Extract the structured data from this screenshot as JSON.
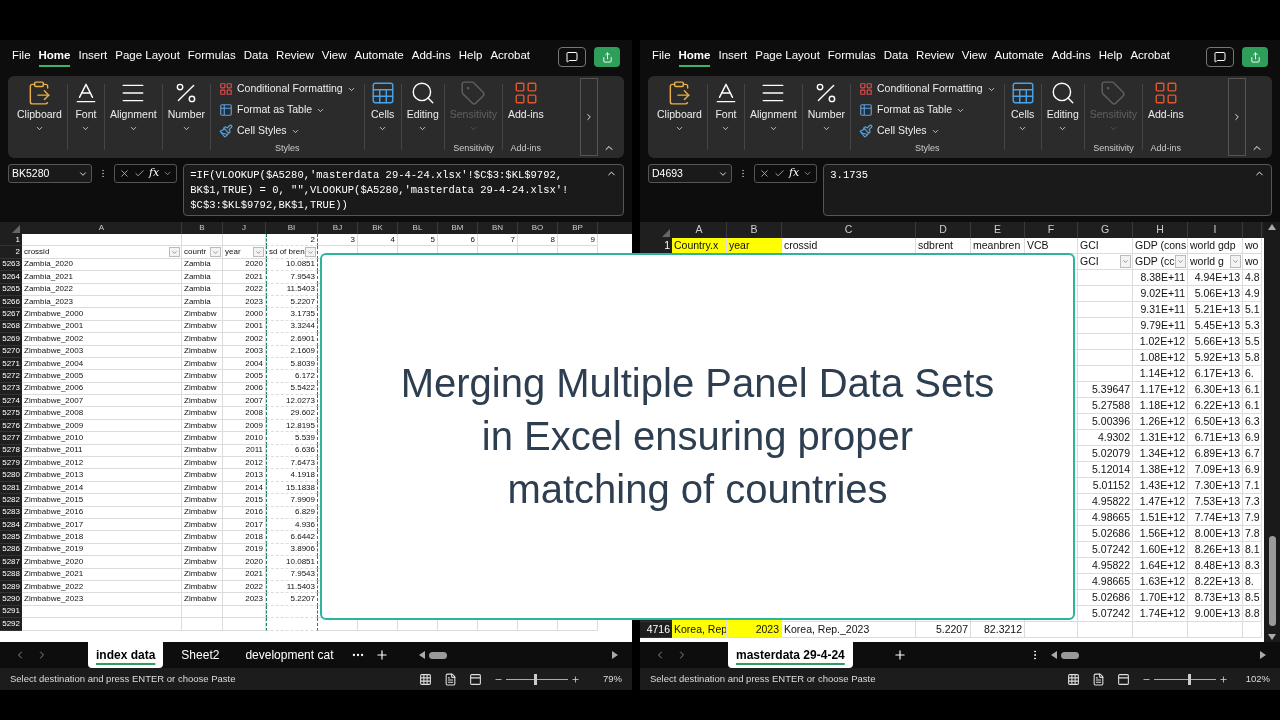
{
  "windows": [
    {
      "menu_tabs": [
        {
          "label": "File",
          "selected": false
        },
        {
          "label": "Home",
          "selected": true
        },
        {
          "label": "Insert",
          "selected": false
        },
        {
          "label": "Page Layout",
          "selected": false
        },
        {
          "label": "Formulas",
          "selected": false
        },
        {
          "label": "Data",
          "selected": false
        },
        {
          "label": "Review",
          "selected": false
        },
        {
          "label": "View",
          "selected": false
        },
        {
          "label": "Automate",
          "selected": false
        },
        {
          "label": "Add-ins",
          "selected": false
        },
        {
          "label": "Help",
          "selected": false
        },
        {
          "label": "Acrobat",
          "selected": false
        }
      ],
      "ribbon": {
        "groups": [
          {
            "kind": "clipboard",
            "label": "Clipboard",
            "disabled": false
          },
          {
            "kind": "font",
            "label": "Font",
            "disabled": false
          },
          {
            "kind": "alignment",
            "label": "Alignment",
            "disabled": false
          },
          {
            "kind": "number",
            "label": "Number",
            "disabled": false
          },
          {
            "kind": "styles",
            "group_label": "Styles",
            "disabled": false,
            "items": [
              {
                "kind": "conditional",
                "label": "Conditional Formatting"
              },
              {
                "kind": "table",
                "label": "Format as Table"
              },
              {
                "kind": "cellstyles",
                "label": "Cell Styles"
              }
            ]
          },
          {
            "kind": "cells",
            "label": "Cells",
            "disabled": false
          },
          {
            "kind": "editing",
            "label": "Editing",
            "disabled": false
          },
          {
            "kind": "sensitivity",
            "label": "Sensitivity",
            "group_label": "Sensitivity",
            "disabled": true
          },
          {
            "kind": "addins",
            "label": "Add-ins",
            "group_label": "Add-ins",
            "disabled": false
          }
        ]
      },
      "name_box": "BK5280",
      "fx": "fx",
      "formula_lines": [
        "=IF(VLOOKUP($A5280,'masterdata 29-4-24.xlsx'!$C$3:$KL$9792,",
        "BK$1,TRUE) = 0, \"\",VLOOKUP($A5280,'masterdata 29-4-24.xlsx'!",
        "$C$3:$KL$9792,BK$1,TRUE))"
      ],
      "grid": {
        "columns": [
          {
            "label": "A",
            "kind": "plain"
          },
          {
            "label": "B",
            "kind": "plain"
          },
          {
            "label": "J",
            "kind": "plain"
          },
          {
            "label": "BI",
            "kind": "copied"
          },
          {
            "label": "BJ",
            "kind": "plain"
          },
          {
            "label": "BK",
            "kind": "plain"
          },
          {
            "label": "BL",
            "kind": "plain"
          },
          {
            "label": "BM",
            "kind": "plain"
          },
          {
            "label": "BN",
            "kind": "plain"
          },
          {
            "label": "BO",
            "kind": "plain"
          },
          {
            "label": "BP",
            "kind": "plain"
          }
        ],
        "rows": [
          {
            "header": "1",
            "kind": "data",
            "cells": [
              null,
              null,
              null,
              "2",
              "3",
              "4",
              "5",
              "6",
              "7",
              "8",
              "9"
            ]
          },
          {
            "header": "2",
            "kind": "header",
            "cells": [
              {
                "text": "crossid",
                "filter": true
              },
              {
                "text": "countr",
                "filter": true
              },
              {
                "text": "year",
                "filter": true
              },
              {
                "text": "sd of bren",
                "filter": true
              }
            ]
          },
          {
            "header": "5263",
            "kind": "data",
            "cells": [
              "Zambia_2020",
              "Zambia",
              "2020",
              "10.0851"
            ]
          },
          {
            "header": "5264",
            "kind": "data",
            "cells": [
              "Zambia_2021",
              "Zambia",
              "2021",
              "7.9543"
            ]
          },
          {
            "header": "5265",
            "kind": "data",
            "cells": [
              "Zambia_2022",
              "Zambia",
              "2022",
              "11.5403"
            ]
          },
          {
            "header": "5266",
            "kind": "data",
            "cells": [
              "Zambia_2023",
              "Zambia",
              "2023",
              "5.2207"
            ]
          },
          {
            "header": "5267",
            "kind": "data",
            "cells": [
              "Zimbabwe_2000",
              "Zimbabw",
              "2000",
              "3.1735"
            ]
          },
          {
            "header": "5268",
            "kind": "data",
            "cells": [
              "Zimbabwe_2001",
              "Zimbabw",
              "2001",
              "3.3244"
            ]
          },
          {
            "header": "5269",
            "kind": "data",
            "cells": [
              "Zimbabwe_2002",
              "Zimbabw",
              "2002",
              "2.6901"
            ]
          },
          {
            "header": "5270",
            "kind": "data",
            "cells": [
              "Zimbabwe_2003",
              "Zimbabw",
              "2003",
              "2.1609"
            ]
          },
          {
            "header": "5271",
            "kind": "data",
            "cells": [
              "Zimbabwe_2004",
              "Zimbabw",
              "2004",
              "5.8039"
            ]
          },
          {
            "header": "5272",
            "kind": "data",
            "cells": [
              "Zimbabwe_2005",
              "Zimbabw",
              "2005",
              "6.172"
            ]
          },
          {
            "header": "5273",
            "kind": "data",
            "cells": [
              "Zimbabwe_2006",
              "Zimbabw",
              "2006",
              "5.5422"
            ]
          },
          {
            "header": "5274",
            "kind": "data",
            "cells": [
              "Zimbabwe_2007",
              "Zimbabw",
              "2007",
              "12.0273"
            ]
          },
          {
            "header": "5275",
            "kind": "data",
            "cells": [
              "Zimbabwe_2008",
              "Zimbabw",
              "2008",
              "29.602"
            ]
          },
          {
            "header": "5276",
            "kind": "data",
            "cells": [
              "Zimbabwe_2009",
              "Zimbabw",
              "2009",
              "12.8195"
            ]
          },
          {
            "header": "5277",
            "kind": "data",
            "cells": [
              "Zimbabwe_2010",
              "Zimbabw",
              "2010",
              "5.539"
            ]
          },
          {
            "header": "5278",
            "kind": "data",
            "cells": [
              "Zimbabwe_2011",
              "Zimbabw",
              "2011",
              "6.636"
            ]
          },
          {
            "header": "5279",
            "kind": "data",
            "cells": [
              "Zimbabwe_2012",
              "Zimbabw",
              "2012",
              "7.6473"
            ]
          },
          {
            "header": "5280",
            "kind": "data",
            "cells": [
              "Zimbabwe_2013",
              "Zimbabw",
              "2013",
              "4.1918"
            ]
          },
          {
            "header": "5281",
            "kind": "data",
            "cells": [
              "Zimbabwe_2014",
              "Zimbabw",
              "2014",
              "15.1838"
            ]
          },
          {
            "header": "5282",
            "kind": "data",
            "cells": [
              "Zimbabwe_2015",
              "Zimbabw",
              "2015",
              "7.9909"
            ]
          },
          {
            "header": "5283",
            "kind": "data",
            "cells": [
              "Zimbabwe_2016",
              "Zimbabw",
              "2016",
              "6.829"
            ]
          },
          {
            "header": "5284",
            "kind": "data",
            "cells": [
              "Zimbabwe_2017",
              "Zimbabw",
              "2017",
              "4.936"
            ]
          },
          {
            "header": "5285",
            "kind": "data",
            "cells": [
              "Zimbabwe_2018",
              "Zimbabw",
              "2018",
              "6.6442"
            ]
          },
          {
            "header": "5286",
            "kind": "data",
            "cells": [
              "Zimbabwe_2019",
              "Zimbabw",
              "2019",
              "3.8906"
            ]
          },
          {
            "header": "5287",
            "kind": "data",
            "cells": [
              "Zimbabwe_2020",
              "Zimbabw",
              "2020",
              "10.0851"
            ]
          },
          {
            "header": "5288",
            "kind": "data",
            "cells": [
              "Zimbabwe_2021",
              "Zimbabw",
              "2021",
              "7.9543"
            ]
          },
          {
            "header": "5289",
            "kind": "data",
            "cells": [
              "Zimbabwe_2022",
              "Zimbabw",
              "2022",
              "11.5403"
            ]
          },
          {
            "header": "5290",
            "kind": "data",
            "cells": [
              "Zimbabwe_2023",
              "Zimbabw",
              "2023",
              "5.2207"
            ]
          },
          {
            "header": "5291",
            "kind": "data",
            "cells": []
          },
          {
            "header": "5292",
            "kind": "data",
            "cells": []
          }
        ]
      },
      "sheet_tabs": [
        {
          "label": "index data",
          "selected": true
        },
        {
          "label": "Sheet2",
          "selected": false
        },
        {
          "label": "development cat",
          "selected": false
        }
      ],
      "status": "Select destination and press ENTER or choose Paste",
      "zoom_slider": {
        "level": 0.45
      },
      "zoom": "79%"
    },
    {
      "menu_tabs": [
        {
          "label": "File",
          "selected": false
        },
        {
          "label": "Home",
          "selected": true
        },
        {
          "label": "Insert",
          "selected": false
        },
        {
          "label": "Page Layout",
          "selected": false
        },
        {
          "label": "Formulas",
          "selected": false
        },
        {
          "label": "Data",
          "selected": false
        },
        {
          "label": "Review",
          "selected": false
        },
        {
          "label": "View",
          "selected": false
        },
        {
          "label": "Automate",
          "selected": false
        },
        {
          "label": "Add-ins",
          "selected": false
        },
        {
          "label": "Help",
          "selected": false
        },
        {
          "label": "Acrobat",
          "selected": false
        }
      ],
      "ribbon": {
        "groups": [
          {
            "kind": "clipboard",
            "label": "Clipboard",
            "disabled": false
          },
          {
            "kind": "font",
            "label": "Font",
            "disabled": false
          },
          {
            "kind": "alignment",
            "label": "Alignment",
            "disabled": false
          },
          {
            "kind": "number",
            "label": "Number",
            "disabled": false
          },
          {
            "kind": "styles",
            "group_label": "Styles",
            "disabled": false,
            "items": [
              {
                "kind": "conditional",
                "label": "Conditional Formatting"
              },
              {
                "kind": "table",
                "label": "Format as Table"
              },
              {
                "kind": "cellstyles",
                "label": "Cell Styles"
              }
            ]
          },
          {
            "kind": "cells",
            "label": "Cells",
            "disabled": false
          },
          {
            "kind": "editing",
            "label": "Editing",
            "disabled": false
          },
          {
            "kind": "sensitivity",
            "label": "Sensitivity",
            "group_label": "Sensitivity",
            "disabled": true
          },
          {
            "kind": "addins",
            "label": "Add-ins",
            "group_label": "Add-ins",
            "disabled": false
          }
        ]
      },
      "name_box": "D4693",
      "fx": "fx",
      "formula_lines": [
        "3.1735"
      ],
      "grid": {
        "columns": [
          {
            "label": "A",
            "kind": "highlighted"
          },
          {
            "label": "B",
            "kind": "highlighted"
          },
          {
            "label": "C",
            "kind": "plain"
          },
          {
            "label": "D",
            "kind": "plain"
          },
          {
            "label": "E",
            "kind": "plain"
          },
          {
            "label": "F",
            "kind": "plain"
          },
          {
            "label": "G",
            "kind": "plain"
          },
          {
            "label": "H",
            "kind": "plain"
          },
          {
            "label": "I",
            "kind": "plain"
          },
          {
            "kind": "plain"
          }
        ],
        "rows": [
          {
            "header": "1",
            "kind": "header",
            "cells": [
              {
                "text": "Country.x",
                "filter": false
              },
              {
                "text": "year",
                "filter": false
              },
              {
                "text": "crossid",
                "filter": false
              },
              {
                "text": "sdbrent",
                "filter": false
              },
              {
                "text": "meanbren",
                "filter": false
              },
              {
                "text": "VCB",
                "filter": false
              },
              {
                "text": "GCI",
                "filter": false
              },
              {
                "text": "GDP (cons",
                "filter": false
              },
              {
                "text": "world gdp",
                "filter": false
              },
              {
                "text": "wo",
                "filter": false
              }
            ]
          },
          {
            "kind": "header",
            "cells": [
              null,
              null,
              null,
              null,
              null,
              null,
              {
                "text": "GCI",
                "filter": true
              },
              {
                "text": "GDP (cc",
                "filter": true
              },
              {
                "text": "world g",
                "filter": true
              },
              {
                "text": "wo",
                "filter": false
              }
            ]
          },
          {
            "kind": "data",
            "cells": [
              null,
              null,
              null,
              null,
              null,
              null,
              null,
              "8.38E+11",
              "4.94E+13",
              "4.8"
            ]
          },
          {
            "kind": "data",
            "cells": [
              null,
              null,
              null,
              null,
              null,
              null,
              null,
              "9.02E+11",
              "5.06E+13",
              "4.9"
            ]
          },
          {
            "kind": "data",
            "cells": [
              null,
              null,
              null,
              null,
              null,
              null,
              null,
              "9.31E+11",
              "5.21E+13",
              "5.1"
            ]
          },
          {
            "kind": "data",
            "cells": [
              null,
              null,
              null,
              null,
              null,
              null,
              null,
              "9.79E+11",
              "5.45E+13",
              "5.3"
            ]
          },
          {
            "kind": "data",
            "cells": [
              null,
              null,
              null,
              null,
              null,
              null,
              null,
              "1.02E+12",
              "5.66E+13",
              "5.5"
            ]
          },
          {
            "kind": "data",
            "cells": [
              null,
              null,
              null,
              null,
              null,
              null,
              null,
              "1.08E+12",
              "5.92E+13",
              "5.8"
            ]
          },
          {
            "kind": "data",
            "cells": [
              null,
              null,
              null,
              null,
              null,
              null,
              null,
              "1.14E+12",
              "6.17E+13",
              "6."
            ]
          },
          {
            "kind": "data",
            "cells": [
              null,
              null,
              null,
              null,
              null,
              null,
              "5.39647",
              "1.17E+12",
              "6.30E+13",
              "6.1"
            ]
          },
          {
            "kind": "data",
            "cells": [
              null,
              null,
              null,
              null,
              null,
              null,
              "5.27588",
              "1.18E+12",
              "6.22E+13",
              "6.1"
            ]
          },
          {
            "kind": "data",
            "cells": [
              null,
              null,
              null,
              null,
              null,
              null,
              "5.00396",
              "1.26E+12",
              "6.50E+13",
              "6.3"
            ]
          },
          {
            "kind": "data",
            "cells": [
              null,
              null,
              null,
              null,
              null,
              null,
              "4.9302",
              "1.31E+12",
              "6.71E+13",
              "6.9"
            ]
          },
          {
            "kind": "data",
            "cells": [
              null,
              null,
              null,
              null,
              null,
              null,
              "5.02079",
              "1.34E+12",
              "6.89E+13",
              "6.7"
            ]
          },
          {
            "kind": "data",
            "cells": [
              null,
              null,
              null,
              null,
              null,
              null,
              "5.12014",
              "1.38E+12",
              "7.09E+13",
              "6.9"
            ]
          },
          {
            "kind": "data",
            "cells": [
              null,
              null,
              null,
              null,
              null,
              null,
              "5.01152",
              "1.43E+12",
              "7.30E+13",
              "7.1"
            ]
          },
          {
            "kind": "data",
            "cells": [
              null,
              null,
              null,
              null,
              null,
              null,
              "4.95822",
              "1.47E+12",
              "7.53E+13",
              "7.3"
            ]
          },
          {
            "kind": "data",
            "cells": [
              null,
              null,
              null,
              null,
              null,
              null,
              "4.98665",
              "1.51E+12",
              "7.74E+13",
              "7.9"
            ]
          },
          {
            "kind": "data",
            "cells": [
              null,
              null,
              null,
              null,
              null,
              null,
              "5.02686",
              "1.56E+12",
              "8.00E+13",
              "7.8"
            ]
          },
          {
            "kind": "data",
            "cells": [
              null,
              null,
              null,
              null,
              null,
              null,
              "5.07242",
              "1.60E+12",
              "8.26E+13",
              "8.1"
            ]
          },
          {
            "kind": "data",
            "cells": [
              null,
              null,
              null,
              null,
              null,
              null,
              "4.95822",
              "1.64E+12",
              "8.48E+13",
              "8.3"
            ]
          },
          {
            "kind": "data",
            "cells": [
              null,
              null,
              null,
              null,
              null,
              null,
              "4.98665",
              "1.63E+12",
              "8.22E+13",
              "8."
            ]
          },
          {
            "kind": "data",
            "cells": [
              null,
              null,
              null,
              null,
              null,
              null,
              "5.02686",
              "1.70E+12",
              "8.73E+13",
              "8.5"
            ]
          },
          {
            "kind": "data",
            "cells": [
              null,
              null,
              null,
              null,
              null,
              null,
              "5.07242",
              "1.74E+12",
              "9.00E+13",
              "8.8"
            ]
          },
          {
            "header": "4716",
            "kind": "data",
            "cells": [
              "Korea, Rep",
              "2023",
              "Korea, Rep._2023",
              "5.2207",
              "82.3212"
            ]
          }
        ]
      },
      "sheet_tabs": [
        {
          "label": "masterdata 29-4-24",
          "selected": true
        }
      ],
      "status": "Select destination and press ENTER or choose Paste",
      "zoom_slider": {
        "level": 0.55
      },
      "zoom": "102%"
    }
  ],
  "title_card": {
    "lines": [
      "Merging Multiple Panel Data Sets",
      "in Excel ensuring proper",
      "matching of countries"
    ]
  }
}
